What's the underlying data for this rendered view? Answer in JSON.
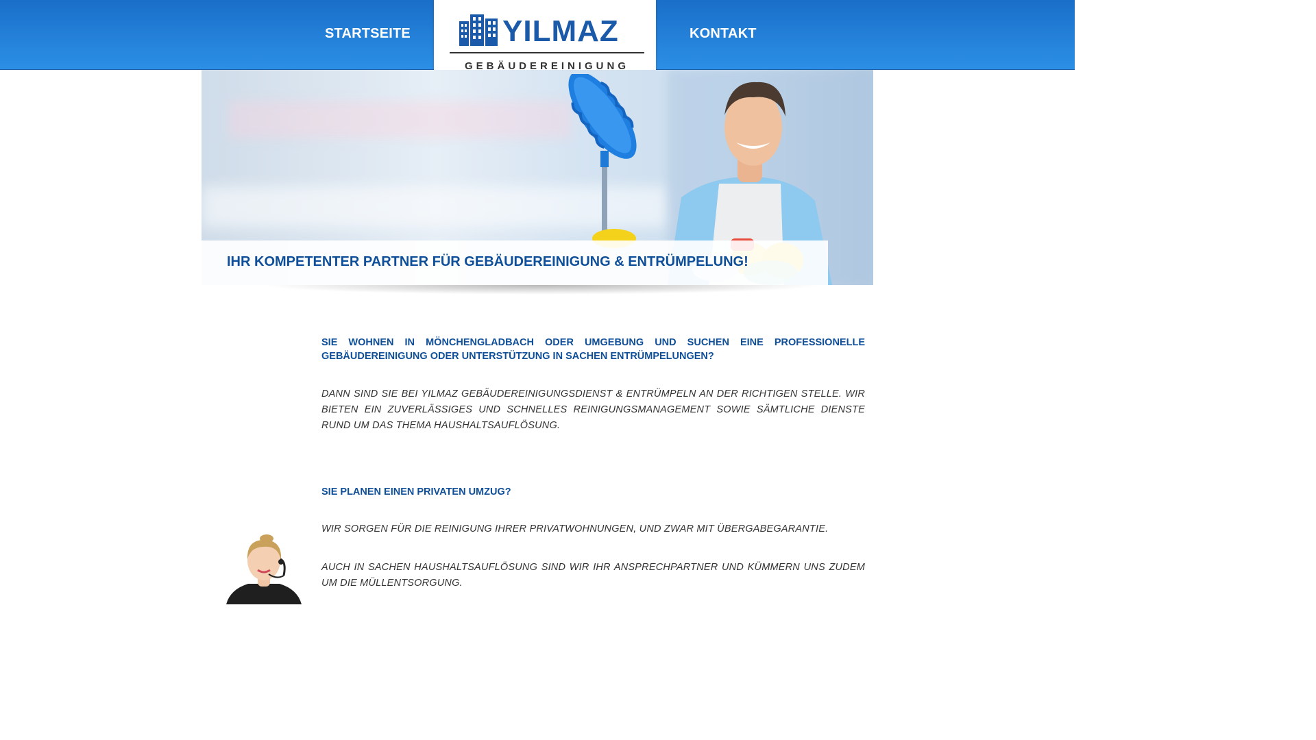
{
  "nav": {
    "home_label": "STARTSEITE",
    "contact_label": "KONTAKT"
  },
  "logo": {
    "name": "YILMAZ",
    "subtitle": "GEBÄUDEREINIGUNG"
  },
  "hero": {
    "title": "IHR KOMPETENTER PARTNER FÜR GEBÄUDEREINIGUNG & ENTRÜMPELUNG!"
  },
  "content": {
    "block1_heading": "SIE WOHNEN IN MÖNCHENGLADBACH ODER UMGEBUNG UND SUCHEN EINE PROFESSIONELLE GEBÄUDEREINIGUNG ODER UNTERSTÜTZUNG IN SACHEN ENTRÜMPELUNGEN?",
    "block1_text": "DANN SIND SIE BEI YILMAZ GEBÄUDEREINIGUNGSDIENST & ENTRÜMPELN AN DER RICHTIGEN STELLE. WIR BIETEN EIN ZUVERLÄSSIGES UND SCHNELLES REINIGUNGSMANAGEMENT SOWIE SÄMTLICHE DIENSTE RUND UM DAS THEMA HAUSHALTSAUFLÖSUNG.",
    "block2_heading": "SIE PLANEN EINEN PRIVATEN UMZUG?",
    "block2_text1": "WIR SORGEN FÜR DIE REINIGUNG IHRER PRIVATWOHNUNGEN, UND ZWAR MIT ÜBERGABEGARANTIE.",
    "block2_text2": "AUCH IN SACHEN HAUSHALTSAUFLÖSUNG SIND WIR IHR ANSPRECHPARTNER UND KÜMMERN UNS ZUDEM UM DIE MÜLLENTSORGUNG."
  },
  "colors": {
    "header_top": "#1a6fc8",
    "header_bottom": "#2c8fe6",
    "heading_blue": "#0f4f99",
    "logo_blue": "#1a5aa8",
    "body_text": "#333333"
  },
  "icons": [
    "building-logo-icon",
    "cleaning-man-photo",
    "support-agent-photo"
  ]
}
